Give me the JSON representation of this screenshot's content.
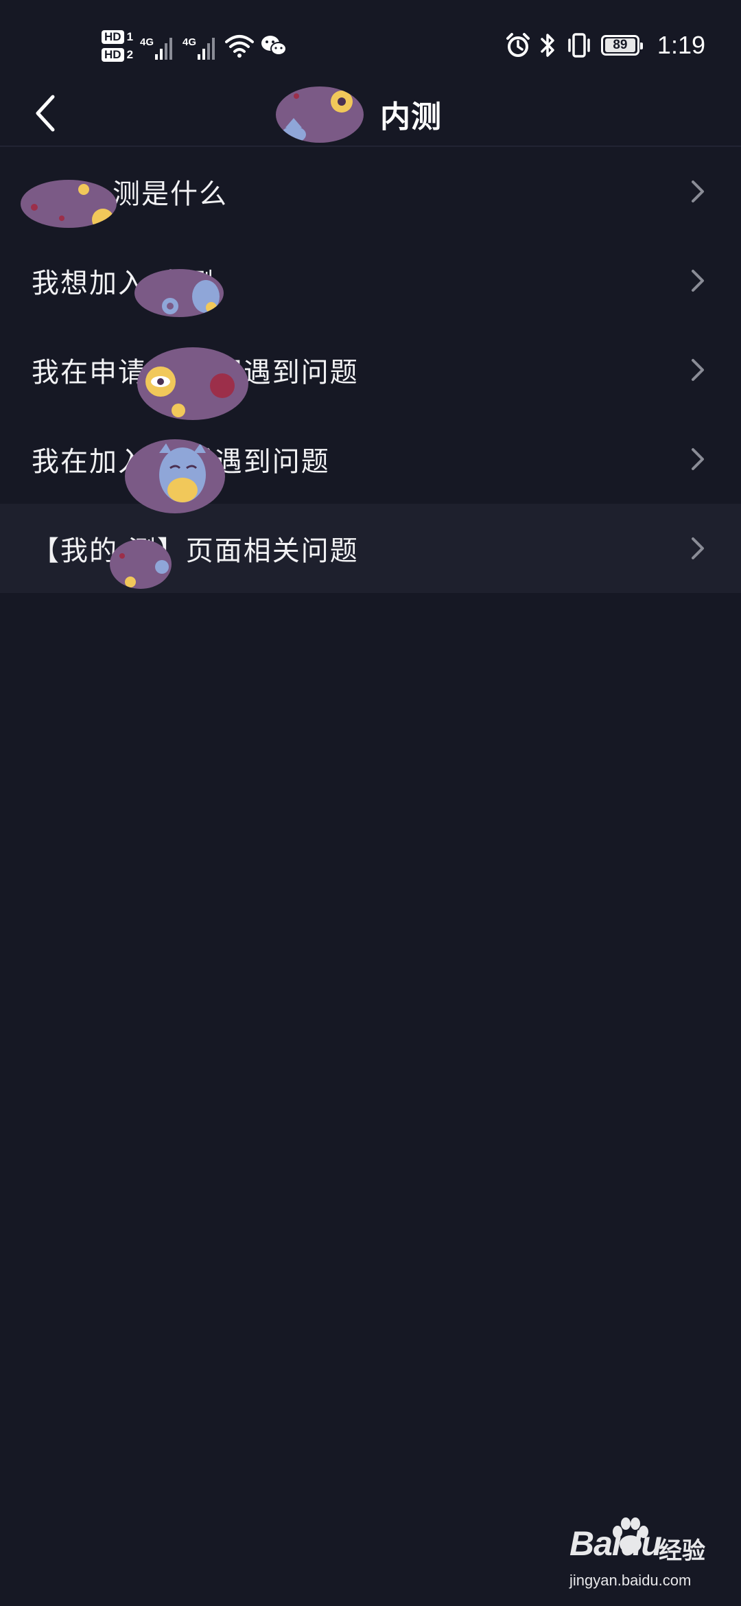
{
  "status_bar": {
    "sim1_label": "HD",
    "sim1_num": "1",
    "sim2_label": "HD",
    "sim2_num": "2",
    "network1": "4G",
    "network2": "4G",
    "battery_level": "89",
    "time": "1:19",
    "icons": [
      "wifi-icon",
      "wechat-icon",
      "alarm-icon",
      "bluetooth-icon",
      "vibrate-icon",
      "battery-icon"
    ]
  },
  "header": {
    "back_icon": "chevron-left-icon",
    "title": "内测"
  },
  "faq": {
    "items": [
      {
        "label": "测是什么",
        "highlighted": false
      },
      {
        "label": "我想加入 内测",
        "highlighted": false
      },
      {
        "label": "我在申请 测期间遇到问题",
        "highlighted": false
      },
      {
        "label": "我在加入 测后遇到问题",
        "highlighted": false
      },
      {
        "label": "【我的 测】页面相关问题",
        "highlighted": true
      }
    ],
    "chevron_icon": "chevron-right-icon"
  },
  "watermark": {
    "brand": "Baidu",
    "cn": "经验",
    "url": "jingyan.baidu.com"
  },
  "colors": {
    "background": "#161824",
    "highlight_row": "#1e202d",
    "text": "#f2f2f4",
    "chevron": "#8a8c96",
    "redaction_sticker": "#7b5a86"
  }
}
